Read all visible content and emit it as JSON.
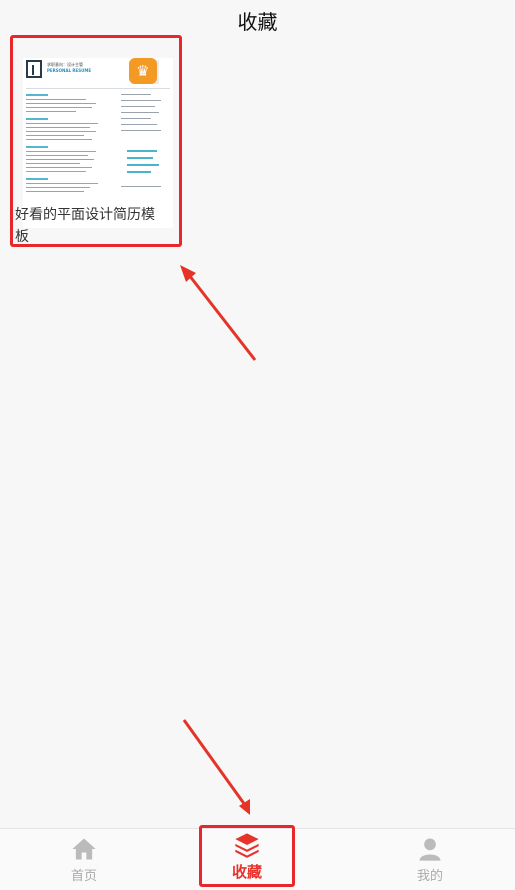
{
  "header": {
    "title": "收藏"
  },
  "favorites": [
    {
      "title": "好看的平面设计简历模板",
      "thumbnail": {
        "name_line": "求职意向：设计主管",
        "subtitle": "PERSONAL RESUME",
        "badge_icon": "crown-icon"
      }
    }
  ],
  "tabbar": {
    "items": [
      {
        "label": "首页",
        "icon": "home-icon",
        "active": false
      },
      {
        "label": "收藏",
        "icon": "layers-icon",
        "active": true
      },
      {
        "label": "我的",
        "icon": "person-icon",
        "active": false
      }
    ]
  },
  "colors": {
    "accent": "#e8332d",
    "highlight_border": "#e8272c",
    "inactive": "#aaaaaa",
    "badge": "#f39a25"
  }
}
